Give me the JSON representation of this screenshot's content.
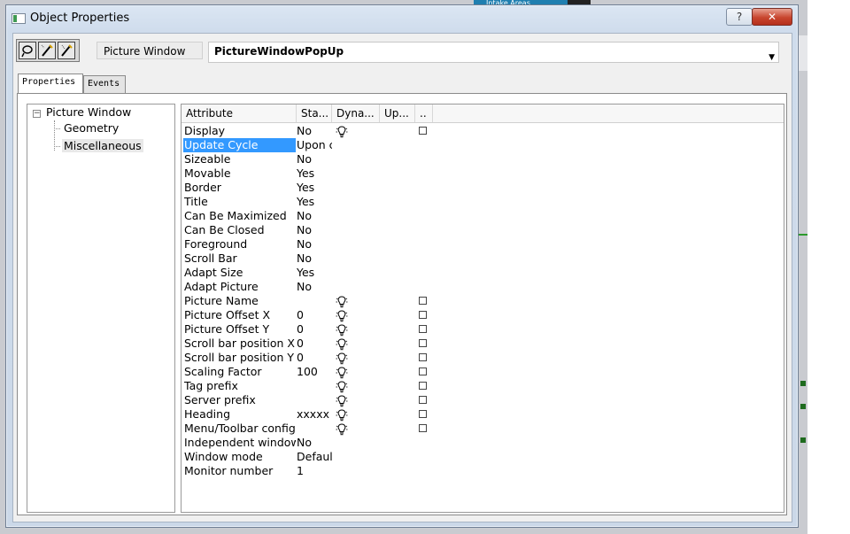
{
  "window": {
    "title": "Object Properties",
    "help_label": "?",
    "close_label": "✕"
  },
  "toolbar": {
    "buttons": [
      {
        "icon": "pin-icon",
        "glyph": "⚲"
      },
      {
        "icon": "wand-icon",
        "glyph": "✎"
      },
      {
        "icon": "brush-icon",
        "glyph": "✎"
      }
    ],
    "object_type": "Picture Window",
    "object_name": "PictureWindowPopUp"
  },
  "tabs": [
    {
      "label": "Properties",
      "active": true
    },
    {
      "label": "Events",
      "active": false
    }
  ],
  "tree": {
    "root": "Picture Window",
    "expander": "−",
    "children": [
      {
        "label": "Geometry",
        "selected": false
      },
      {
        "label": "Miscellaneous",
        "selected": true
      }
    ]
  },
  "grid": {
    "columns": [
      "Attribute",
      "Sta...",
      "Dyna...",
      "Up...",
      ".."
    ],
    "rows": [
      {
        "attribute": "Display",
        "static": "No",
        "dynamic": true,
        "checkbox": true
      },
      {
        "attribute": "Update Cycle",
        "static": "Upon c",
        "dynamic": false,
        "checkbox": false,
        "selected": true
      },
      {
        "attribute": "Sizeable",
        "static": "No",
        "dynamic": false,
        "checkbox": false
      },
      {
        "attribute": "Movable",
        "static": "Yes",
        "dynamic": false,
        "checkbox": false
      },
      {
        "attribute": "Border",
        "static": "Yes",
        "dynamic": false,
        "checkbox": false
      },
      {
        "attribute": "Title",
        "static": "Yes",
        "dynamic": false,
        "checkbox": false
      },
      {
        "attribute": "Can Be Maximized",
        "static": "No",
        "dynamic": false,
        "checkbox": false
      },
      {
        "attribute": "Can Be Closed",
        "static": "No",
        "dynamic": false,
        "checkbox": false
      },
      {
        "attribute": "Foreground",
        "static": "No",
        "dynamic": false,
        "checkbox": false
      },
      {
        "attribute": "Scroll Bar",
        "static": "No",
        "dynamic": false,
        "checkbox": false
      },
      {
        "attribute": "Adapt Size",
        "static": "Yes",
        "dynamic": false,
        "checkbox": false
      },
      {
        "attribute": "Adapt Picture",
        "static": "No",
        "dynamic": false,
        "checkbox": false
      },
      {
        "attribute": "Picture Name",
        "static": "",
        "dynamic": true,
        "checkbox": true
      },
      {
        "attribute": "Picture Offset X",
        "static": "0",
        "dynamic": true,
        "checkbox": true
      },
      {
        "attribute": "Picture Offset Y",
        "static": "0",
        "dynamic": true,
        "checkbox": true
      },
      {
        "attribute": "Scroll bar position X",
        "static": "0",
        "dynamic": true,
        "checkbox": true
      },
      {
        "attribute": "Scroll bar position Y",
        "static": "0",
        "dynamic": true,
        "checkbox": true
      },
      {
        "attribute": "Scaling Factor",
        "static": "100",
        "dynamic": true,
        "checkbox": true
      },
      {
        "attribute": "Tag prefix",
        "static": "",
        "dynamic": true,
        "checkbox": true
      },
      {
        "attribute": "Server prefix",
        "static": "",
        "dynamic": true,
        "checkbox": true
      },
      {
        "attribute": "Heading",
        "static": "xxxxx",
        "dynamic": true,
        "checkbox": true
      },
      {
        "attribute": "Menu/Toolbar config",
        "static": "",
        "dynamic": true,
        "checkbox": true
      },
      {
        "attribute": "Independent window",
        "static": "No",
        "dynamic": false,
        "checkbox": false
      },
      {
        "attribute": "Window mode",
        "static": "Default",
        "dynamic": false,
        "checkbox": false
      },
      {
        "attribute": "Monitor number",
        "static": "1",
        "dynamic": false,
        "checkbox": false
      }
    ]
  },
  "background": {
    "tab_label": "Intake Areas"
  },
  "colors": {
    "selection": "#3399ff",
    "close_button": "#c8452e",
    "frame": "#cbd8e8"
  }
}
